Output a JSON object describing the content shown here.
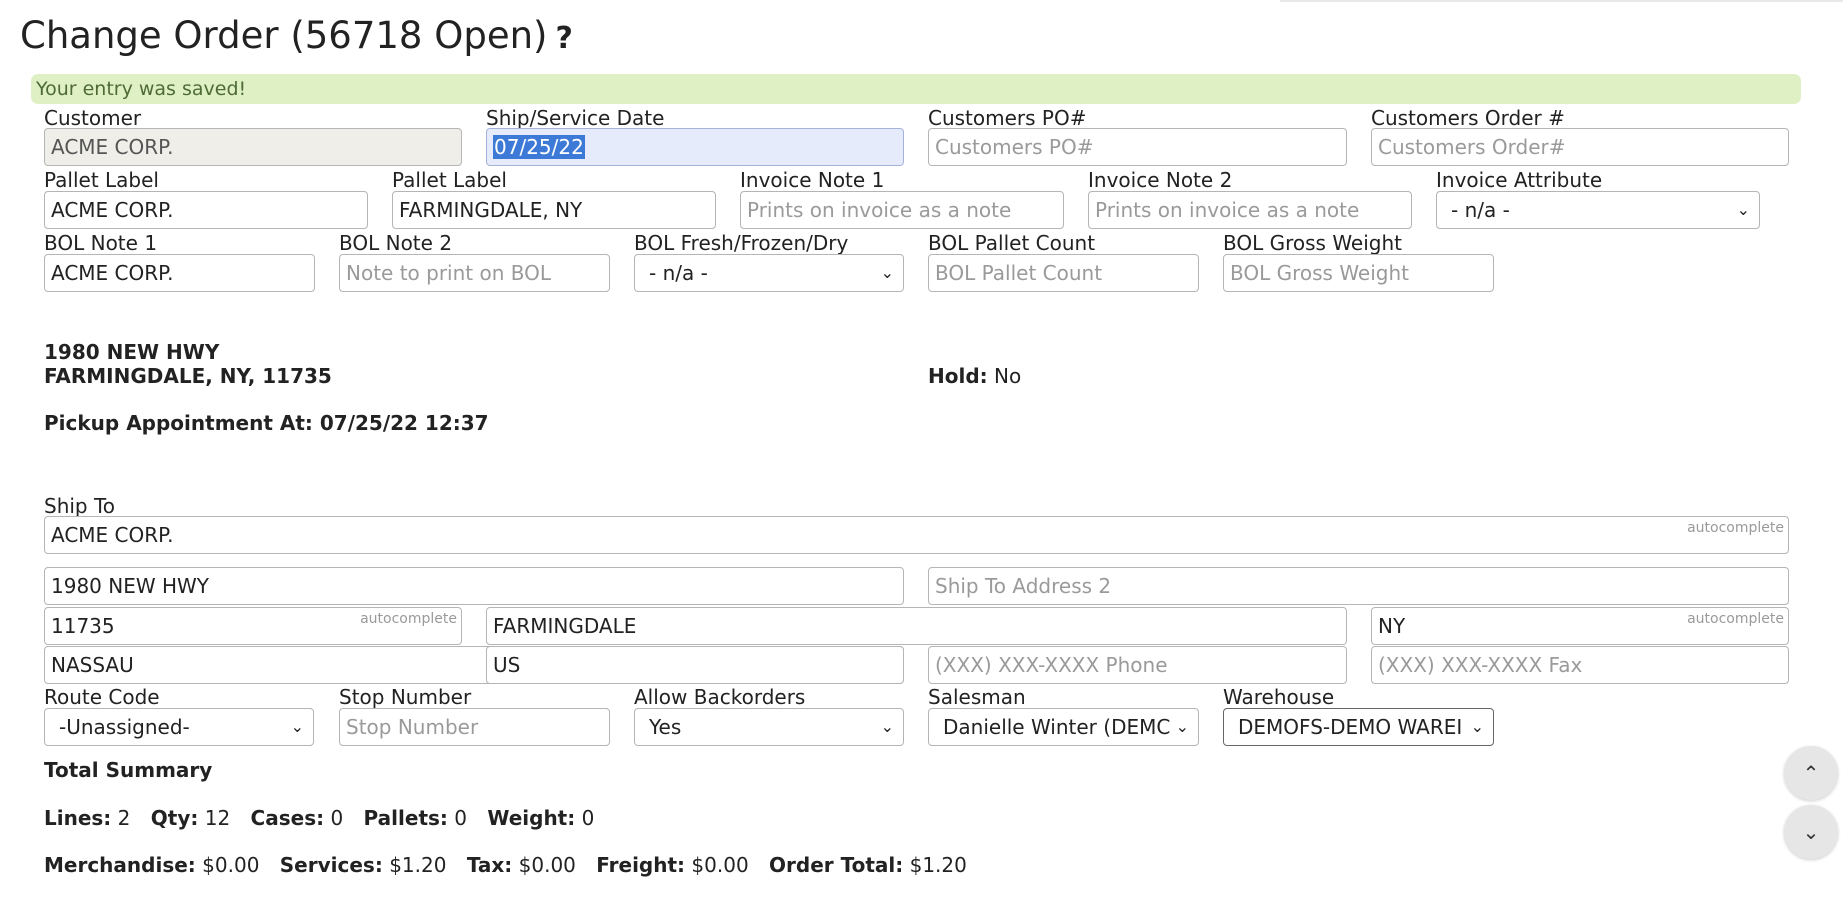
{
  "header": {
    "title": "Change Order (56718 Open)",
    "help_glyph": "?"
  },
  "alert": {
    "message": "Your entry was saved!"
  },
  "row1": {
    "customer": {
      "label": "Customer",
      "value": "ACME CORP."
    },
    "ship_date": {
      "label": "Ship/Service Date",
      "value": "07/25/22"
    },
    "customers_po": {
      "label": "Customers PO#",
      "placeholder": "Customers PO#"
    },
    "customers_order": {
      "label": "Customers Order #",
      "placeholder": "Customers Order#"
    }
  },
  "row2": {
    "pallet_label_1": {
      "label": "Pallet Label",
      "value": "ACME CORP."
    },
    "pallet_label_2": {
      "label": "Pallet Label",
      "value": "FARMINGDALE, NY"
    },
    "invoice_note_1": {
      "label": "Invoice Note 1",
      "placeholder": "Prints on invoice as a note"
    },
    "invoice_note_2": {
      "label": "Invoice Note 2",
      "placeholder": "Prints on invoice as a note"
    },
    "invoice_attribute": {
      "label": "Invoice Attribute",
      "selected": "- n/a -"
    }
  },
  "row3": {
    "bol_note_1": {
      "label": "BOL Note 1",
      "value": "ACME CORP."
    },
    "bol_note_2": {
      "label": "BOL Note 2",
      "placeholder": "Note to print on BOL"
    },
    "bol_fresh": {
      "label": "BOL Fresh/Frozen/Dry",
      "selected": "- n/a -"
    },
    "bol_pallet_count": {
      "label": "BOL Pallet Count",
      "placeholder": "BOL Pallet Count"
    },
    "bol_gross_weight": {
      "label": "BOL Gross Weight",
      "placeholder": "BOL Gross Weight"
    }
  },
  "address_block": {
    "line1": "1980 NEW HWY",
    "line2": "FARMINGDALE, NY, 11735"
  },
  "hold": {
    "label": "Hold:",
    "value": "No"
  },
  "pickup": {
    "text": "Pickup Appointment At: 07/25/22 12:37"
  },
  "ship_to": {
    "label": "Ship To",
    "name": "ACME CORP.",
    "address1": "1980 NEW HWY",
    "address2_placeholder": "Ship To Address 2",
    "zip": "11735",
    "city": "FARMINGDALE",
    "state": "NY",
    "county": "NASSAU",
    "country": "US",
    "phone_placeholder": "(XXX) XXX-XXXX Phone",
    "fax_placeholder": "(XXX) XXX-XXXX Fax",
    "autocomplete_hint": "autocomplete"
  },
  "row_bottom": {
    "route_code": {
      "label": "Route Code",
      "selected": "-Unassigned-"
    },
    "stop_number": {
      "label": "Stop Number",
      "placeholder": "Stop Number"
    },
    "allow_backorders": {
      "label": "Allow Backorders",
      "selected": "Yes"
    },
    "salesman": {
      "label": "Salesman",
      "selected": "Danielle Winter (DEMC"
    },
    "warehouse": {
      "label": "Warehouse",
      "selected": "DEMOFS-DEMO WAREI"
    }
  },
  "summary": {
    "title": "Total Summary",
    "lines_label": "Lines:",
    "lines": "2",
    "qty_label": "Qty:",
    "qty": "12",
    "cases_label": "Cases:",
    "cases": "0",
    "pallets_label": "Pallets:",
    "pallets": "0",
    "weight_label": "Weight:",
    "weight": "0",
    "merch_label": "Merchandise:",
    "merch": "$0.00",
    "services_label": "Services:",
    "services": "$1.20",
    "tax_label": "Tax:",
    "tax": "$0.00",
    "freight_label": "Freight:",
    "freight": "$0.00",
    "total_label": "Order Total:",
    "total": "$1.20"
  },
  "icons": {
    "chevron": "chevron-down-icon",
    "scroll_up": "chevron-up-icon",
    "scroll_down": "chevron-down-icon"
  }
}
